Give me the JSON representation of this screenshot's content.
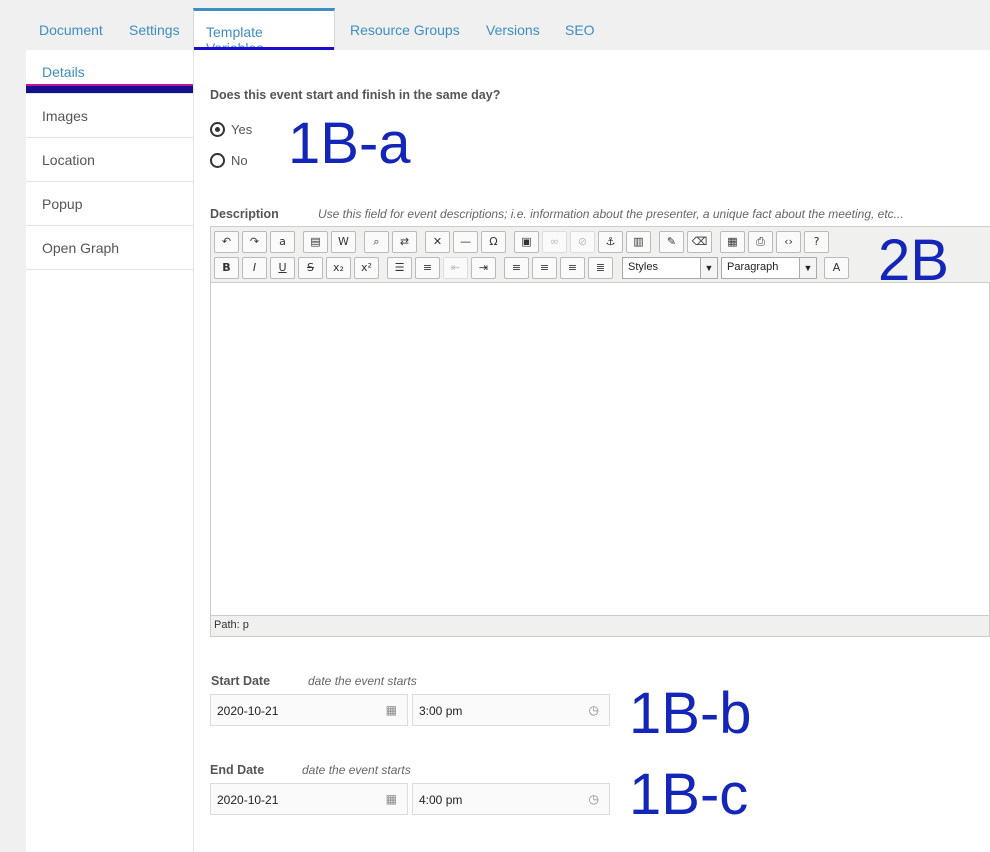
{
  "tabs": [
    "Document",
    "Settings",
    "Template Variables",
    "Resource Groups",
    "Versions",
    "SEO"
  ],
  "side_tabs": [
    "Details",
    "Images",
    "Location",
    "Popup",
    "Open Graph"
  ],
  "question": "Does this event start and finish in the same day?",
  "options": [
    "Yes",
    "No"
  ],
  "selected_option": "Yes",
  "description_label": "Description",
  "description_help": "Use this field for event descriptions; i.e. information about the presenter, a unique fact about the meeting, etc...",
  "styles_select": "Styles",
  "format_select": "Paragraph",
  "path_text": "Path: p",
  "start_label": "Start Date",
  "start_help": "date the event starts",
  "start_date": "2020-10-21",
  "start_time": "3:00 pm",
  "end_label": "End Date",
  "end_help": "date the event starts",
  "end_date": "2020-10-21",
  "end_time": "4:00 pm",
  "annotations": [
    "1B-a",
    "2B",
    "1B-b",
    "1B-c"
  ]
}
